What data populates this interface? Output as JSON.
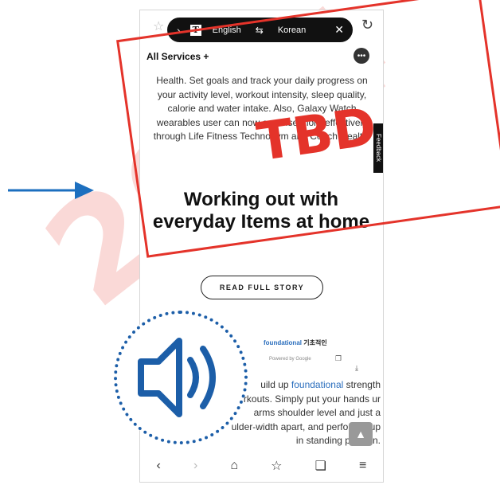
{
  "watermark": "2024",
  "translate_bar": {
    "source_language": "English",
    "target_language": "Korean"
  },
  "header": {
    "all_services_label": "All Services",
    "plus_symbol": "+"
  },
  "article": {
    "health_paragraph": "Health. Set goals and track your daily progress on your activity level, workout intensity, sleep quality, calorie and water intake. Also, Galaxy Watch wearables user can now exercise more effectively through Life Fitness Technogym and Coach Health.",
    "headline": "Working out with everyday Items at home",
    "read_full_story": "READ FULL STORY"
  },
  "dictionary_popup": {
    "keyword": "foundational",
    "korean": "기초적인",
    "powered_by": "Powered by Google"
  },
  "body_text": {
    "part1": "uild up ",
    "highlight": "foundational",
    "part2": " strength orkouts. Simply put your hands ur arms shoulder level and just a ulder-width apart, and perform a up in standing position."
  },
  "feedback_label": "Feedback",
  "stamp": {
    "text": "TBD",
    "color": "#e4332a"
  },
  "icons": {
    "arrow_color": "#1c6fbf",
    "speaker_color": "#1c5ea8"
  }
}
